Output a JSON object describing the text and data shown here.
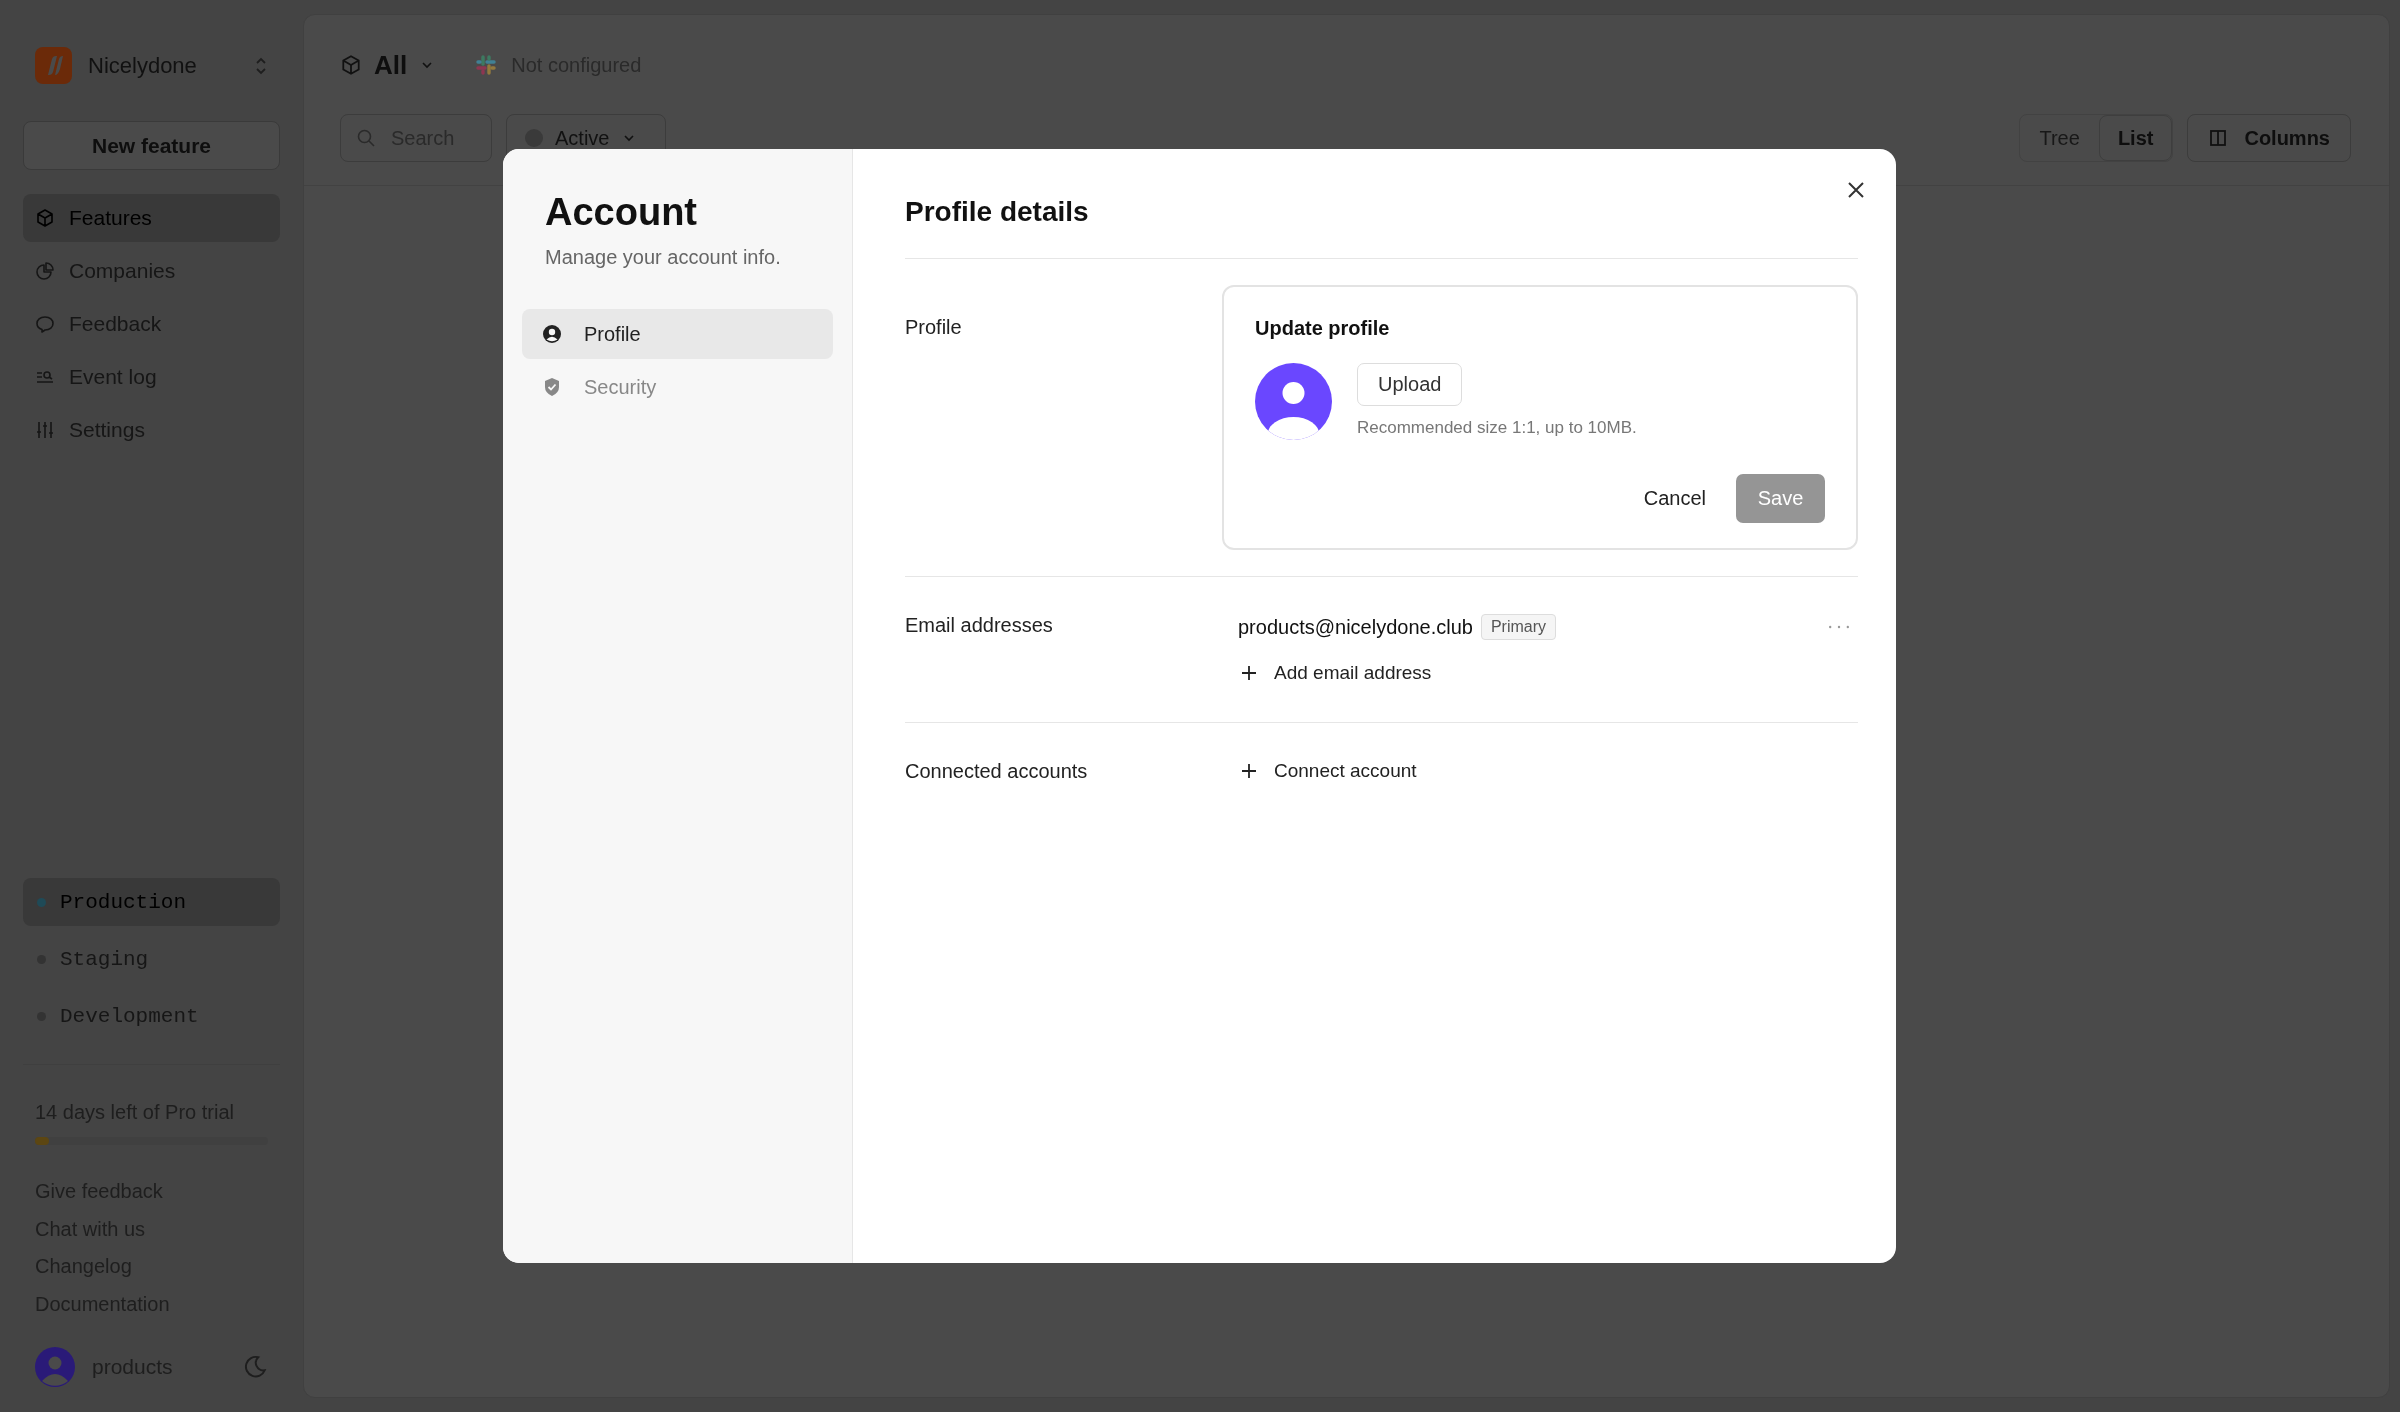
{
  "sidebar": {
    "workspace": "Nicelydone",
    "new_button": "New feature",
    "nav": [
      {
        "label": "Features",
        "selected": true
      },
      {
        "label": "Companies",
        "selected": false
      },
      {
        "label": "Feedback",
        "selected": false
      },
      {
        "label": "Event log",
        "selected": false
      },
      {
        "label": "Settings",
        "selected": false
      }
    ],
    "environments": [
      {
        "label": "Production",
        "selected": true,
        "color": "#1f4a57"
      },
      {
        "label": "Staging",
        "selected": false,
        "color": "#333333"
      },
      {
        "label": "Development",
        "selected": false,
        "color": "#333333"
      }
    ],
    "trial": {
      "text": "14 days left of Pro trial",
      "level": 0.06
    },
    "links": [
      "Give feedback",
      "Chat with us",
      "Changelog",
      "Documentation"
    ],
    "user": {
      "name": "products"
    }
  },
  "toolbar": {
    "scope": "All",
    "integration": "Not configured",
    "search": {
      "placeholder": "Search"
    },
    "status_filter": "Active",
    "views": [
      {
        "label": "Tree",
        "selected": false
      },
      {
        "label": "List",
        "selected": true
      }
    ],
    "columns_button": "Columns"
  },
  "modal": {
    "title": "Account",
    "subtitle": "Manage your account info.",
    "nav": [
      {
        "label": "Profile",
        "selected": true,
        "kind": "profile"
      },
      {
        "label": "Security",
        "selected": false,
        "kind": "security"
      }
    ],
    "heading": "Profile details",
    "profile": {
      "label": "Profile",
      "card_title": "Update profile",
      "upload": "Upload",
      "hint": "Recommended size 1:1, up to 10MB.",
      "cancel": "Cancel",
      "save": "Save",
      "save_disabled": true
    },
    "emails": {
      "label": "Email addresses",
      "items": [
        {
          "address": "products@nicelydone.club",
          "badge": "Primary"
        }
      ],
      "add": "Add email address"
    },
    "connected": {
      "label": "Connected accounts",
      "add": "Connect account"
    }
  }
}
